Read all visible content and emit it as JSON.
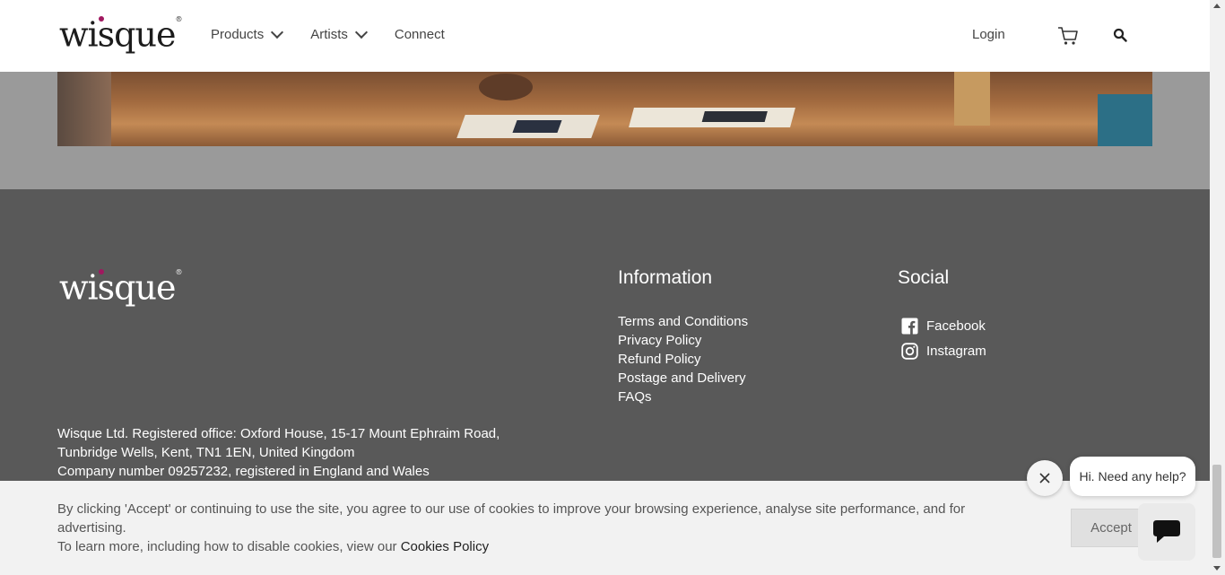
{
  "header": {
    "logo": "wisque",
    "logo_mark": "®",
    "nav": [
      {
        "label": "Products",
        "icon": "chevron-down-icon"
      },
      {
        "label": "Artists",
        "icon": "chevron-down-icon"
      },
      {
        "label": "Connect"
      }
    ],
    "login_label": "Login",
    "cart_icon": "cart-icon",
    "search_icon": "search-icon"
  },
  "footer": {
    "logo": "wisque",
    "logo_mark": "®",
    "information": {
      "title": "Information",
      "links": [
        "Terms and Conditions",
        "Privacy Policy",
        "Refund Policy",
        "Postage and Delivery",
        "FAQs"
      ]
    },
    "social": {
      "title": "Social",
      "links": [
        {
          "label": "Facebook",
          "icon": "facebook-icon"
        },
        {
          "label": "Instagram",
          "icon": "instagram-icon"
        }
      ]
    },
    "address": [
      "Wisque Ltd. Registered office: Oxford House, 15-17 Mount Ephraim Road,",
      "Tunbridge Wells, Kent, TN1 1EN, United Kingdom",
      "Company number 09257232, registered in England and Wales"
    ]
  },
  "cookie": {
    "text": "By clicking 'Accept' or continuing to use the site, you agree to our use of cookies to improve your browsing experience, analyse site performance, and for advertising.",
    "more_prefix": "To learn more, including how to disable cookies, view our ",
    "policy_link": "Cookies Policy",
    "accept_label": "Accept"
  },
  "chat": {
    "greeting": "Hi. Need any help?"
  },
  "colors": {
    "brand_dot": "#a0185f",
    "footer_bg": "#595959",
    "cookie_bg": "#f2f2f2"
  }
}
